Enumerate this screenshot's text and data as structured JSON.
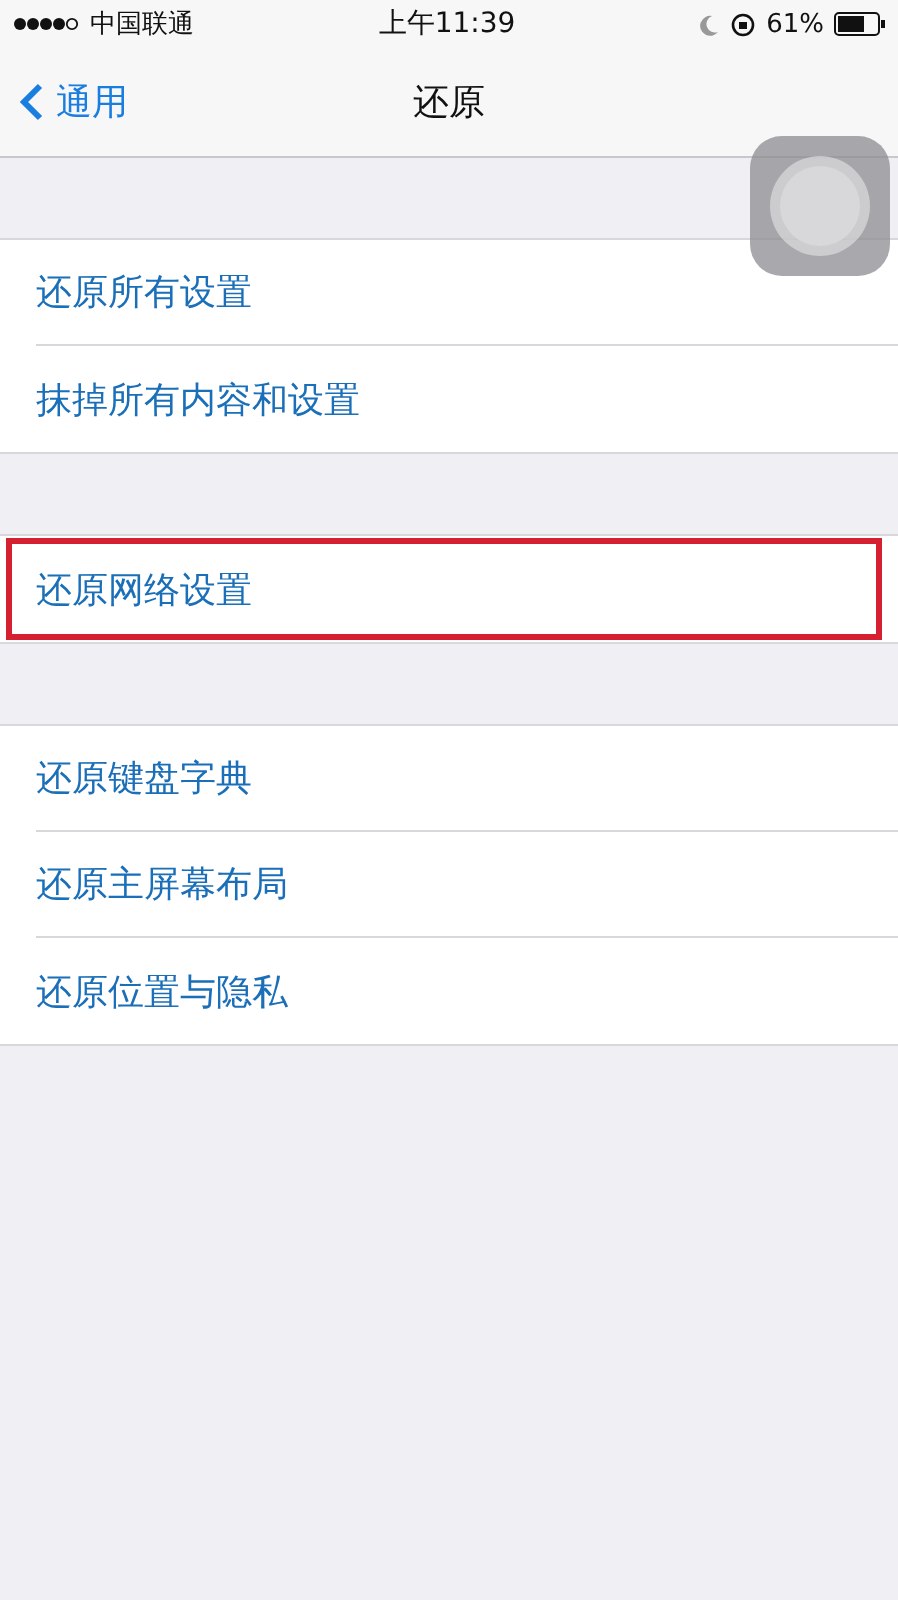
{
  "status_bar": {
    "carrier": "中国联通",
    "time": "上午11:39",
    "battery": "61%"
  },
  "nav": {
    "back": "通用",
    "title": "还原"
  },
  "groups": [
    {
      "items": [
        {
          "label": "还原所有设置",
          "highlighted": false
        },
        {
          "label": "抹掉所有内容和设置",
          "highlighted": false
        }
      ]
    },
    {
      "items": [
        {
          "label": "还原网络设置",
          "highlighted": true
        }
      ]
    },
    {
      "items": [
        {
          "label": "还原键盘字典",
          "highlighted": false
        },
        {
          "label": "还原主屏幕布局",
          "highlighted": false
        },
        {
          "label": "还原位置与隐私",
          "highlighted": false
        }
      ]
    }
  ]
}
